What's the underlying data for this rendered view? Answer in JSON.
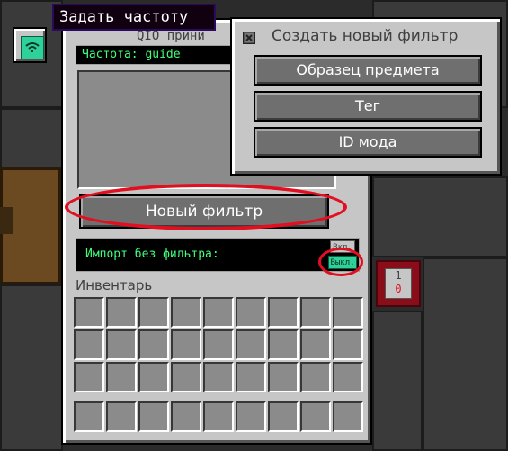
{
  "tooltip": {
    "text": "Задать частоту"
  },
  "panel": {
    "title": "QIO прини",
    "frequency": "Частота: guide",
    "new_filter_label": "Новый фильтр",
    "import_label": "Импорт без фильтра:",
    "toggle_on_label": "Вкл.",
    "toggle_off_label": "Выкл.",
    "inventory_label": "Инвентарь"
  },
  "popup": {
    "title": "Создать новый фильтр",
    "options": [
      "Образец предмета",
      "Тег",
      "ID мода"
    ]
  },
  "side_badge": {
    "top": "1",
    "bottom": "0"
  },
  "colors": {
    "accent": "#2fd19a",
    "frequency_text": "#3fff7a",
    "highlight": "#e01020",
    "panel": "#c6c6c6",
    "button": "#6f6f6f",
    "badge": "#8a0e1a"
  },
  "icons": {
    "frequency_button": "wifi-signal-icon",
    "popup_close": "close-icon"
  }
}
